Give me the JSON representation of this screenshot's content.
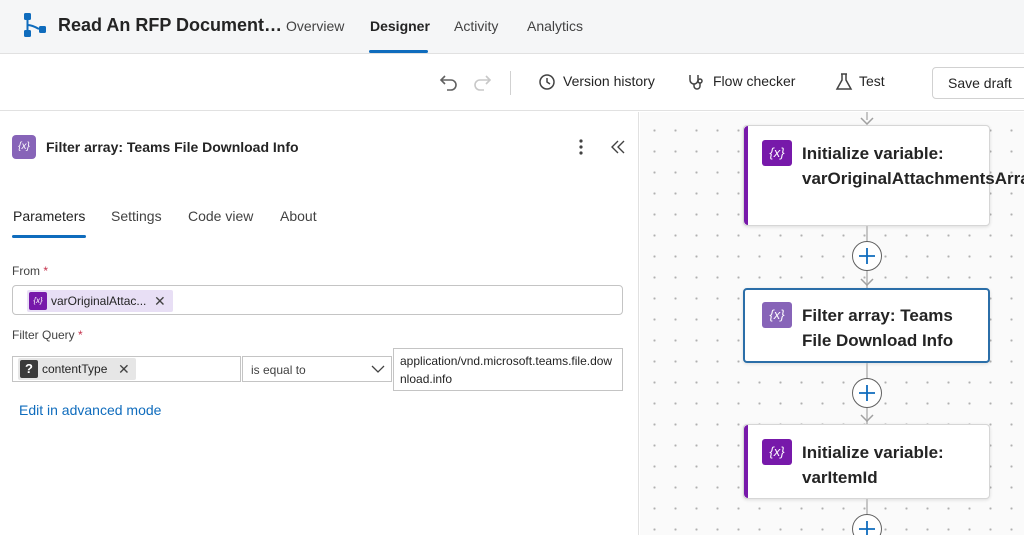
{
  "app": {
    "title": "Read An RFP Document…"
  },
  "nav": {
    "tabs": [
      "Overview",
      "Designer",
      "Activity",
      "Analytics"
    ],
    "active": "Designer"
  },
  "toolbar": {
    "version_history": "Version history",
    "flow_checker": "Flow checker",
    "test": "Test",
    "save_draft": "Save draft"
  },
  "panel": {
    "icon_text": "{x}",
    "title": "Filter array: Teams File Download Info",
    "tabs": [
      "Parameters",
      "Settings",
      "Code view",
      "About"
    ],
    "from_label": "From",
    "from_token": "varOriginalAttac...",
    "filter_query_label": "Filter Query",
    "required_mark": "*",
    "filter_left_token": "contentType",
    "filter_operator": "is equal to",
    "filter_value": "application/vnd.microsoft.teams.file.download.info",
    "advanced_link": "Edit in advanced mode",
    "remove_glyph": "✕",
    "qmark": "?"
  },
  "canvas": {
    "cards": [
      {
        "icon": "{x}",
        "title": "Initialize variable: varOriginalAttachmentsArray",
        "color": "#7719aa"
      },
      {
        "icon": "{x}",
        "title": "Filter array: Teams File Download Info",
        "color": "#8764b8",
        "selected": true
      },
      {
        "icon": "{x}",
        "title": "Initialize variable: varItemId",
        "color": "#7719aa"
      }
    ]
  },
  "colors": {
    "accent": "#0f6cbd",
    "variable": "#7719aa",
    "filter": "#8764b8",
    "selected_border": "#2b6ea8"
  }
}
